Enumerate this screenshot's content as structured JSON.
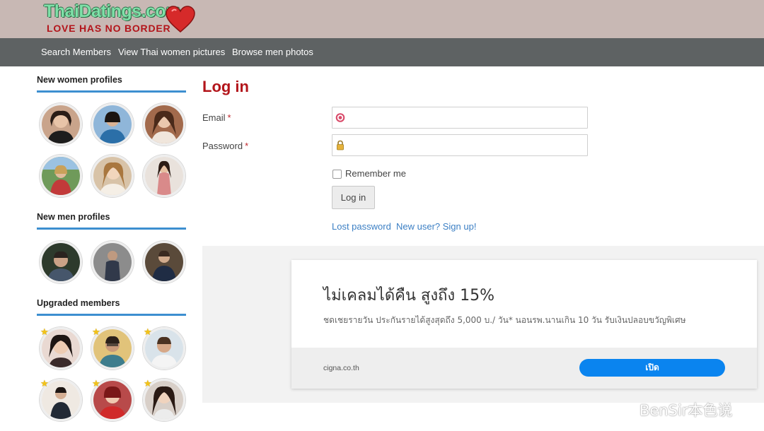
{
  "header": {
    "logo_title": "ThaiDatings.com",
    "logo_tagline": "LOVE HAS NO BORDER",
    "logo_heart_color": "#d62a2a"
  },
  "nav": {
    "items": [
      "Search Members",
      "View Thai women pictures",
      "Browse men photos"
    ]
  },
  "sidebar": {
    "women_title": "New women profiles",
    "men_title": "New men profiles",
    "upgraded_title": "Upgraded members",
    "upgraded_badge": "★",
    "accent_color": "#3d8fd0"
  },
  "login": {
    "title": "Log in",
    "email_label": "Email",
    "password_label": "Password",
    "required_mark": "*",
    "email_value": "",
    "password_value": "",
    "remember_label": "Remember me",
    "remember_checked": false,
    "submit_label": "Log in",
    "lost_password_link": "Lost password",
    "signup_link": "New user? Sign up!",
    "title_color": "#b3151b"
  },
  "ad": {
    "headline": "ไม่เคลมได้คืน สูงถึง 15%",
    "description": "ชดเชยรายวัน ประกันรายได้สูงสุดถึง 5,000 บ./ วัน* นอนรพ.นานเกิน 10 วัน รับเงินปลอบขวัญพิเศษ",
    "domain": "cigna.co.th",
    "cta_label": "เปิด",
    "cta_color": "#0a84ef"
  },
  "watermark": {
    "text": "BenSir本色说"
  }
}
